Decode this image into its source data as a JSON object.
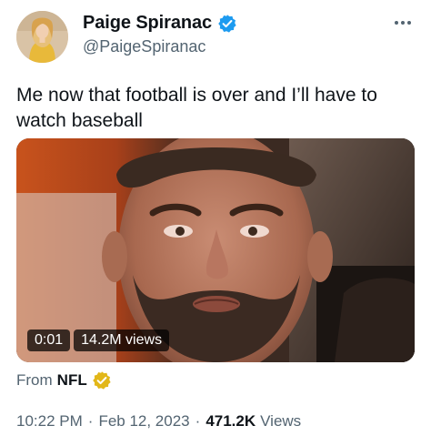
{
  "author": {
    "display_name": "Paige Spiranac",
    "handle": "@PaigeSpiranac",
    "verified_icon": "blue-verified-check-icon"
  },
  "tweet": {
    "text": "Me now that football is over and I’ll have to\nwatch baseball"
  },
  "media": {
    "duration": "0:01",
    "views": "14.2M views"
  },
  "source": {
    "from_label": "From",
    "name": "NFL",
    "badge_icon": "gold-verified-check-icon"
  },
  "meta": {
    "time": "10:22 PM",
    "separator": "·",
    "date": "Feb 12, 2023",
    "views_count": "471.2K",
    "views_label": "Views"
  },
  "colors": {
    "text_primary": "#0f1419",
    "text_secondary": "#536471",
    "verified_blue": "#1d9bf0",
    "verified_gold": "#e2b719"
  }
}
